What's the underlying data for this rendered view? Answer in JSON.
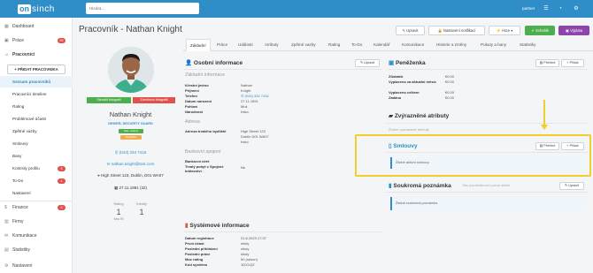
{
  "topbar": {
    "logo_mark": "on",
    "logo_text": "sinch",
    "search_placeholder": "Hledat...",
    "user": "partner",
    "icons": [
      "menu-icon",
      "notifications-icon",
      "settings-icon"
    ]
  },
  "sidebar": {
    "items": [
      {
        "label": "Dashboard",
        "icon": "dashboard-icon"
      },
      {
        "label": "Práce",
        "icon": "briefcase-icon",
        "badge": "99"
      },
      {
        "label": "Pracovníci",
        "icon": "users-icon"
      }
    ],
    "add_button": "+ PŘIDAT PRACOVNÍKA",
    "sub_items": [
      {
        "label": "Seznam pracovníků",
        "active": true
      },
      {
        "label": "Pracovníci timeline"
      },
      {
        "label": "Rating"
      },
      {
        "label": "Problémové účasti"
      },
      {
        "label": "Zpětné vazby"
      },
      {
        "label": "Smlouvy"
      },
      {
        "label": "Bany"
      },
      {
        "label": "Kontroly profilu",
        "badge": "5"
      },
      {
        "label": "To-Do",
        "badge": "4"
      },
      {
        "label": "Nastavení"
      }
    ],
    "bottom_items": [
      {
        "label": "Finance",
        "icon": "finance-icon",
        "badge": "5"
      },
      {
        "label": "Firmy",
        "icon": "building-icon"
      },
      {
        "label": "Komunikace",
        "icon": "mail-icon"
      },
      {
        "label": "Statistiky",
        "icon": "chart-icon"
      },
      {
        "label": "Nastavení",
        "icon": "gear-icon"
      }
    ]
  },
  "header": {
    "title": "Pracovník - Nathan Knight",
    "buttons": {
      "edit": "Upravit",
      "notifications": "Nastavení notifikací",
      "actions": "Akce",
      "approve": "Schválit",
      "payout": "Výplata"
    }
  },
  "tabs": [
    "Základní",
    "Práce",
    "Události",
    "Atributy",
    "Zpětné vazby",
    "Rating",
    "To-Do",
    "Kalendář",
    "Komunikace",
    "Historie a změny",
    "Pokuty a bany",
    "Statistiky"
  ],
  "profile": {
    "approve_photo": "Schválit fotografii",
    "reject_photo": "Zamítnout fotografii",
    "name": "Nathan Knight",
    "role": "DRIVER, SECURITY GUARD",
    "tags": [
      "Stav: Aktivní",
      "Nováček"
    ],
    "phone": "(043) 334 7416",
    "email": "nathan.knight@test.com",
    "address": "High Street 123, Dublin, D01 WA07",
    "birthdate": "27.11.1991 (32)",
    "rating_label": "Rating",
    "rating_value": "1",
    "rating_sub": "New 99",
    "cancel_label": "Kredity",
    "cancel_value": "1"
  },
  "personal": {
    "title": "Osobní informace",
    "edit": "Upravit",
    "basic_title": "Základní informace",
    "fields": [
      {
        "k": "Křestní jméno",
        "v": "Nathan"
      },
      {
        "k": "Příjmení",
        "v": "Knight"
      },
      {
        "k": "Telefon",
        "v": "(043) 334 7416"
      },
      {
        "k": "Datum narození",
        "v": "27.11.1991"
      },
      {
        "k": "Pohlaví",
        "v": "Muž"
      },
      {
        "k": "Národnost",
        "v": "Irsko"
      }
    ],
    "address_title": "Adresa",
    "address_label": "Adresa trvalého bydliště",
    "address_lines": [
      "High Street 123",
      "Dublin D01 WA07",
      "Irsko"
    ],
    "bank_title": "Bankovní spojení",
    "bank_fields": [
      {
        "k": "Bankovní účet",
        "v": ""
      },
      {
        "k": "Trvalý pobyt v Spojené království",
        "v": "Ne"
      }
    ]
  },
  "system": {
    "title": "Systémové informace",
    "fields": [
      {
        "k": "Datum registrace",
        "v": "21.6.2023 17:37"
      },
      {
        "k": "První účast",
        "v": "nikdy"
      },
      {
        "k": "Poslední přihlášení",
        "v": "nikdy"
      },
      {
        "k": "Poslední práce",
        "v": "nikdy"
      },
      {
        "k": "Moc rating",
        "v": "50 (sekun)"
      },
      {
        "k": "Kód systému",
        "v": "1DX1QZ"
      }
    ]
  },
  "wallet": {
    "title": "Peněženka",
    "overview": "Přehled",
    "add": "Přidat",
    "rows": [
      {
        "k": "Zůstatek",
        "v": "€0.00"
      },
      {
        "k": "Vyplaceno za aktuální měsíc",
        "v": "€0.00"
      },
      {
        "k": "Vyplaceno celkem",
        "v": "€0.00"
      },
      {
        "k": "Zadáno",
        "v": "€0.00"
      }
    ]
  },
  "attributes": {
    "title": "Zvýrazněné atributy",
    "empty": "Žádné vyznačené atributy"
  },
  "contracts": {
    "title": "Smlouvy",
    "overview": "Přehled",
    "add": "Přidat",
    "empty": "Žádné aktivní smlouvy"
  },
  "note": {
    "title": "Soukromá poznámka",
    "subtitle": "Tato poznámka není pouze admin",
    "edit": "Upravit",
    "empty": "Žádná soukromá poznámka."
  },
  "colors": {
    "brand": "#2f8ec7",
    "approve": "#4cae4c",
    "payout": "#8e44ad",
    "highlight": "#f0cf2d",
    "danger": "#e0524b"
  }
}
